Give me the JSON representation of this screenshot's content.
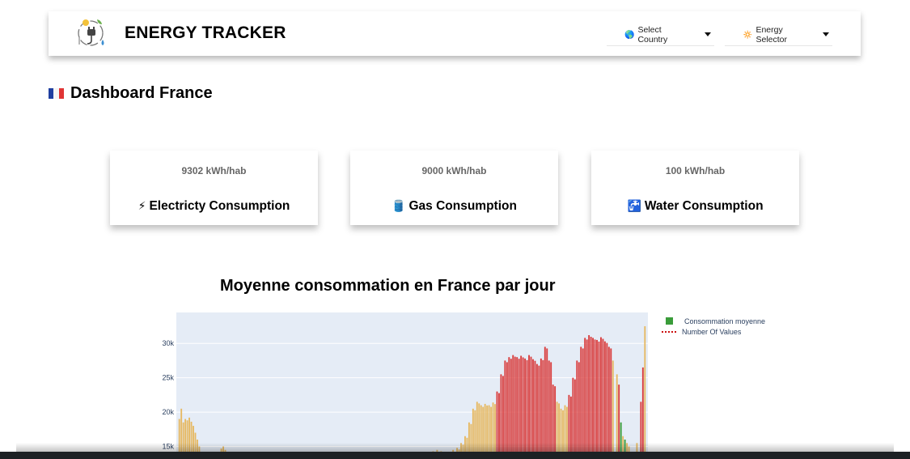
{
  "header": {
    "brand": "ENERGY TRACKER",
    "logo_icon": "energy-logo-icon",
    "country_dropdown": {
      "icon": "🌎",
      "label": "Select Country"
    },
    "energy_dropdown": {
      "icon": "🔅",
      "label": "Energy Selector"
    }
  },
  "dashboard": {
    "flag_icon": "france-flag-icon",
    "title": "Dashboard France"
  },
  "cards": [
    {
      "value": "9302 kWh/hab",
      "icon": "⚡",
      "label": "Electricty Consumption"
    },
    {
      "value": "9000 kWh/hab",
      "icon": "🛢️",
      "label": "Gas Consumption"
    },
    {
      "value": "100 kWh/hab",
      "icon": "🚰",
      "label": "Water Consumption"
    }
  ],
  "chart": {
    "title": "Moyenne consommation en France par jour",
    "legend": [
      {
        "name": "Consommation moyenne",
        "color": "#3a9c3a"
      },
      {
        "name": "Number Of Values",
        "color": "#cc1111"
      }
    ],
    "colors": {
      "plot_bg": "#e5ecf6",
      "orange": "#e6b963",
      "red": "#d93c3c",
      "green": "#3a9c3a"
    }
  },
  "chart_data": {
    "type": "bar",
    "title": "Moyenne consommation en France par jour",
    "ylim": [
      14000,
      34500
    ],
    "yticks": [
      15000,
      20000,
      25000,
      30000
    ],
    "ytick_labels": [
      "15k",
      "20k",
      "25k",
      "30k"
    ],
    "xlabel": "",
    "ylabel": "",
    "series": [
      {
        "name": "Consommation moyenne",
        "color": "#3a9c3a"
      },
      {
        "name": "Number Of Values",
        "color": "#cc1111"
      }
    ],
    "values": [
      {
        "i": 0,
        "v": 14000,
        "c": "o"
      },
      {
        "i": 1,
        "v": 19000,
        "c": "o"
      },
      {
        "i": 2,
        "v": 20500,
        "c": "o"
      },
      {
        "i": 3,
        "v": 18500,
        "c": "o"
      },
      {
        "i": 4,
        "v": 19000,
        "c": "o"
      },
      {
        "i": 5,
        "v": 18800,
        "c": "o"
      },
      {
        "i": 6,
        "v": 19200,
        "c": "o"
      },
      {
        "i": 7,
        "v": 18600,
        "c": "o"
      },
      {
        "i": 8,
        "v": 18000,
        "c": "o"
      },
      {
        "i": 9,
        "v": 17000,
        "c": "o"
      },
      {
        "i": 10,
        "v": 16000,
        "c": "o"
      },
      {
        "i": 11,
        "v": 15000,
        "c": "o"
      },
      {
        "i": 22,
        "v": 14700,
        "c": "o"
      },
      {
        "i": 23,
        "v": 15000,
        "c": "o"
      },
      {
        "i": 24,
        "v": 14500,
        "c": "o"
      },
      {
        "i": 128,
        "v": 14300,
        "c": "o"
      },
      {
        "i": 130,
        "v": 14500,
        "c": "o"
      },
      {
        "i": 132,
        "v": 14300,
        "c": "o"
      },
      {
        "i": 136,
        "v": 14200,
        "c": "o"
      },
      {
        "i": 138,
        "v": 14500,
        "c": "o"
      },
      {
        "i": 140,
        "v": 14800,
        "c": "o"
      },
      {
        "i": 142,
        "v": 15500,
        "c": "o"
      },
      {
        "i": 144,
        "v": 16500,
        "c": "o"
      },
      {
        "i": 146,
        "v": 18500,
        "c": "o"
      },
      {
        "i": 148,
        "v": 20500,
        "c": "o"
      },
      {
        "i": 150,
        "v": 21500,
        "c": "o"
      },
      {
        "i": 152,
        "v": 21000,
        "c": "o"
      },
      {
        "i": 154,
        "v": 21200,
        "c": "o"
      },
      {
        "i": 156,
        "v": 21000,
        "c": "o"
      },
      {
        "i": 158,
        "v": 21400,
        "c": "o"
      },
      {
        "i": 160,
        "v": 23000,
        "c": "r"
      },
      {
        "i": 162,
        "v": 25500,
        "c": "r"
      },
      {
        "i": 164,
        "v": 27500,
        "c": "r"
      },
      {
        "i": 166,
        "v": 28000,
        "c": "r"
      },
      {
        "i": 168,
        "v": 28300,
        "c": "r"
      },
      {
        "i": 170,
        "v": 28000,
        "c": "r"
      },
      {
        "i": 172,
        "v": 28200,
        "c": "r"
      },
      {
        "i": 174,
        "v": 27800,
        "c": "r"
      },
      {
        "i": 176,
        "v": 28300,
        "c": "r"
      },
      {
        "i": 178,
        "v": 27700,
        "c": "r"
      },
      {
        "i": 180,
        "v": 27000,
        "c": "r"
      },
      {
        "i": 182,
        "v": 27800,
        "c": "r"
      },
      {
        "i": 184,
        "v": 29500,
        "c": "r"
      },
      {
        "i": 186,
        "v": 27500,
        "c": "r"
      },
      {
        "i": 188,
        "v": 24000,
        "c": "r"
      },
      {
        "i": 190,
        "v": 21500,
        "c": "o"
      },
      {
        "i": 192,
        "v": 20500,
        "c": "o"
      },
      {
        "i": 194,
        "v": 21000,
        "c": "o"
      },
      {
        "i": 196,
        "v": 22500,
        "c": "r"
      },
      {
        "i": 198,
        "v": 25000,
        "c": "r"
      },
      {
        "i": 200,
        "v": 27500,
        "c": "r"
      },
      {
        "i": 202,
        "v": 29500,
        "c": "r"
      },
      {
        "i": 204,
        "v": 30800,
        "c": "r"
      },
      {
        "i": 206,
        "v": 31200,
        "c": "r"
      },
      {
        "i": 208,
        "v": 30800,
        "c": "r"
      },
      {
        "i": 210,
        "v": 30500,
        "c": "r"
      },
      {
        "i": 212,
        "v": 30900,
        "c": "r"
      },
      {
        "i": 214,
        "v": 30300,
        "c": "r"
      },
      {
        "i": 216,
        "v": 29500,
        "c": "r"
      },
      {
        "i": 218,
        "v": 27500,
        "c": "o"
      },
      {
        "i": 220,
        "v": 25500,
        "c": "o"
      },
      {
        "i": 221,
        "v": 24000,
        "c": "r"
      },
      {
        "i": 222,
        "v": 18500,
        "c": "g"
      },
      {
        "i": 223,
        "v": 16500,
        "c": "o"
      },
      {
        "i": 224,
        "v": 16000,
        "c": "g"
      },
      {
        "i": 225,
        "v": 15500,
        "c": "o"
      },
      {
        "i": 226,
        "v": 15000,
        "c": "o"
      },
      {
        "i": 230,
        "v": 15500,
        "c": "o"
      },
      {
        "i": 232,
        "v": 21500,
        "c": "r"
      },
      {
        "i": 233,
        "v": 26500,
        "c": "r"
      },
      {
        "i": 234,
        "v": 32500,
        "c": "o"
      }
    ]
  }
}
